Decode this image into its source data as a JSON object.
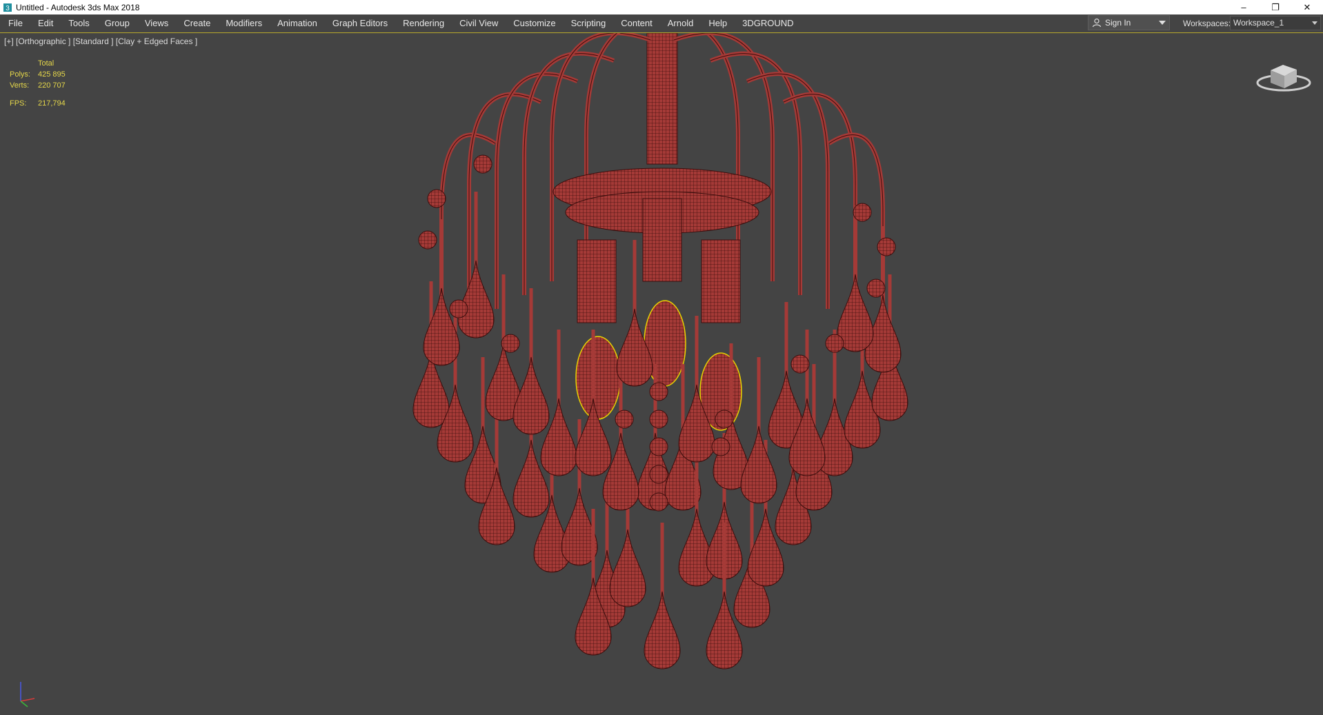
{
  "window": {
    "title": "Untitled - Autodesk 3ds Max 2018",
    "controls": {
      "minimize": "–",
      "restore": "❐",
      "close": "✕"
    }
  },
  "menu": {
    "items": [
      "File",
      "Edit",
      "Tools",
      "Group",
      "Views",
      "Create",
      "Modifiers",
      "Animation",
      "Graph Editors",
      "Rendering",
      "Civil View",
      "Customize",
      "Scripting",
      "Content",
      "Arnold",
      "Help",
      "3DGROUND"
    ]
  },
  "account": {
    "signin_label": "Sign In"
  },
  "workspaces": {
    "label": "Workspaces:",
    "selected": "Workspace_1"
  },
  "viewport": {
    "label": "[+] [Orthographic ] [Standard ] [Clay + Edged Faces ]",
    "stats": {
      "header": "Total",
      "polys_label": "Polys:",
      "polys_value": "425 895",
      "verts_label": "Verts:",
      "verts_value": "220 707",
      "fps_label": "FPS:",
      "fps_value": "217,794"
    },
    "background_color": "#444444",
    "model_color": "#a53a37",
    "selection_color": "#e8d400"
  },
  "icons": {
    "app": "3ds-max-icon",
    "user": "user-icon",
    "viewcube": "viewcube-icon",
    "axis": "axis-tripod-icon"
  }
}
